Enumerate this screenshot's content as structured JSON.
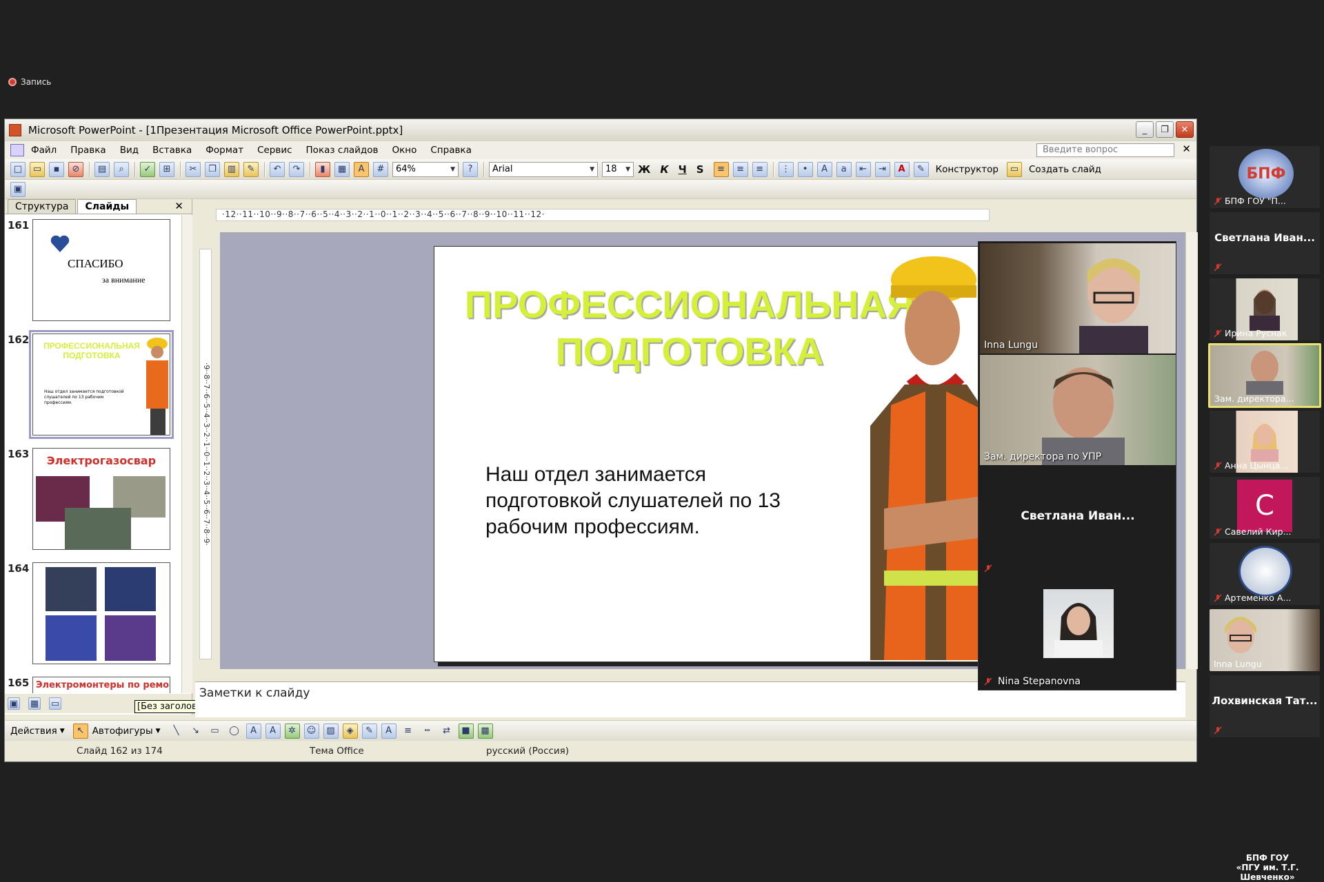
{
  "recording": {
    "label": "Запись"
  },
  "window": {
    "title": "Microsoft PowerPoint - [1Презентация Microsoft Office PowerPoint.pptx]",
    "buttons": {
      "minimize": "_",
      "restore": "❐",
      "close": "✕"
    }
  },
  "menu": {
    "items": [
      "Файл",
      "Правка",
      "Вид",
      "Вставка",
      "Формат",
      "Сервис",
      "Показ слайдов",
      "Окно",
      "Справка"
    ],
    "ask_placeholder": "Введите вопрос",
    "close": "✕"
  },
  "toolbar": {
    "zoom": "64%",
    "font": "Arial",
    "font_size": "18",
    "bold": "Ж",
    "italic": "К",
    "underline": "Ч",
    "shadow": "S",
    "designer_label": "Конструктор",
    "new_slide_label": "Создать слайд"
  },
  "pane": {
    "tabs": [
      "Структура",
      "Слайды"
    ],
    "close": "✕",
    "slides": [
      {
        "num": "161",
        "title": "СПАСИБО",
        "subtitle": "за внимание"
      },
      {
        "num": "162",
        "title": "ПРОФЕССИОНАЛЬНАЯ ПОДГОТОВКА",
        "body": "Наш отдел занимается подготовкой слушателей по 13 рабочим профессиям."
      },
      {
        "num": "163",
        "title": "Электрогазосвар"
      },
      {
        "num": "164"
      },
      {
        "num": "165",
        "title": "Электромонтеры по ремонту"
      }
    ],
    "tooltip": "[Без заголовка]"
  },
  "ruler": {
    "h": "·12··11··10··9··8··7··6··5··4··3··2··1··0··1··2··3··4··5··6··7··8··9··10··11··12·",
    "v": "·9··8··7··6··5··4··3··2··1··0··1··2··3··4··5··6··7··8··9·"
  },
  "slide": {
    "title_line1": "ПРОФЕССИОНАЛЬНАЯ",
    "title_line2": "ПОДГОТОВКА",
    "body": "Наш отдел занимается подготовкой слушателей по 13 рабочим профессиям."
  },
  "notes": {
    "placeholder": "Заметки к слайду"
  },
  "drawbar": {
    "actions": "Действия",
    "autoshapes": "Автофигуры"
  },
  "status": {
    "slide": "Слайд 162 из 174",
    "theme": "Тема Office",
    "lang": "русский (Россия)"
  },
  "video": [
    {
      "name": "Inna Lungu"
    },
    {
      "name": "Зам. директора по УПР"
    },
    {
      "name": "Светлана  Иван..."
    },
    {
      "name": "Nina Stepanovna"
    }
  ],
  "participants": [
    {
      "name": "БПФ ГОУ \"П...",
      "logo": "БПФ"
    },
    {
      "name": "Светлана  Иван..."
    },
    {
      "name": "Ирина Руснак"
    },
    {
      "name": "Зам. директора..."
    },
    {
      "name": "Анна Цынца..."
    },
    {
      "name": "Савелий Кир...",
      "initial": "С"
    },
    {
      "name": "Артеменко А..."
    },
    {
      "name": "Inna Lungu"
    },
    {
      "name": "Лохвинская  Тат..."
    }
  ],
  "brand": {
    "line1": "БПФ ГОУ",
    "line2": "«ПГУ им. Т.Г. Шевченко»"
  },
  "colors": {
    "slide_title": "#d6ef3a",
    "highlight": "#e8e070",
    "mic_muted": "#d23b30",
    "avatar_pink": "#c2185b"
  }
}
